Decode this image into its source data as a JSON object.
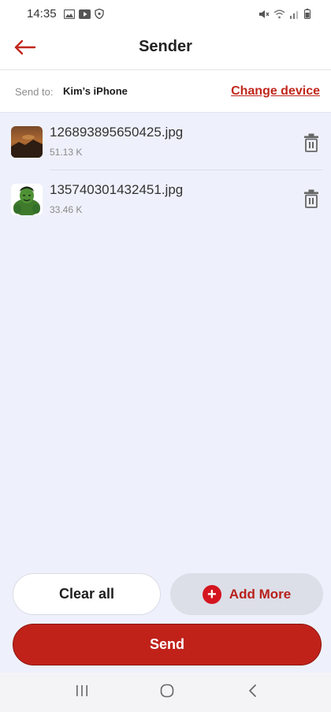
{
  "status_bar": {
    "time": "14:35"
  },
  "header": {
    "title": "Sender"
  },
  "send_to": {
    "label": "Send to:",
    "device": "Kim’s iPhone",
    "change_link": "Change device"
  },
  "files": [
    {
      "name": "126893895650425.jpg",
      "size": "51.13 K",
      "thumb_icon": "landscape-photo"
    },
    {
      "name": "135740301432451.jpg",
      "size": "33.46 K",
      "thumb_icon": "hulk-photo"
    }
  ],
  "buttons": {
    "clear_all": "Clear all",
    "add_more": "Add More",
    "send": "Send"
  },
  "colors": {
    "accent": "#c0221a",
    "list_bg": "#eef1fb",
    "link": "#c0271c"
  }
}
